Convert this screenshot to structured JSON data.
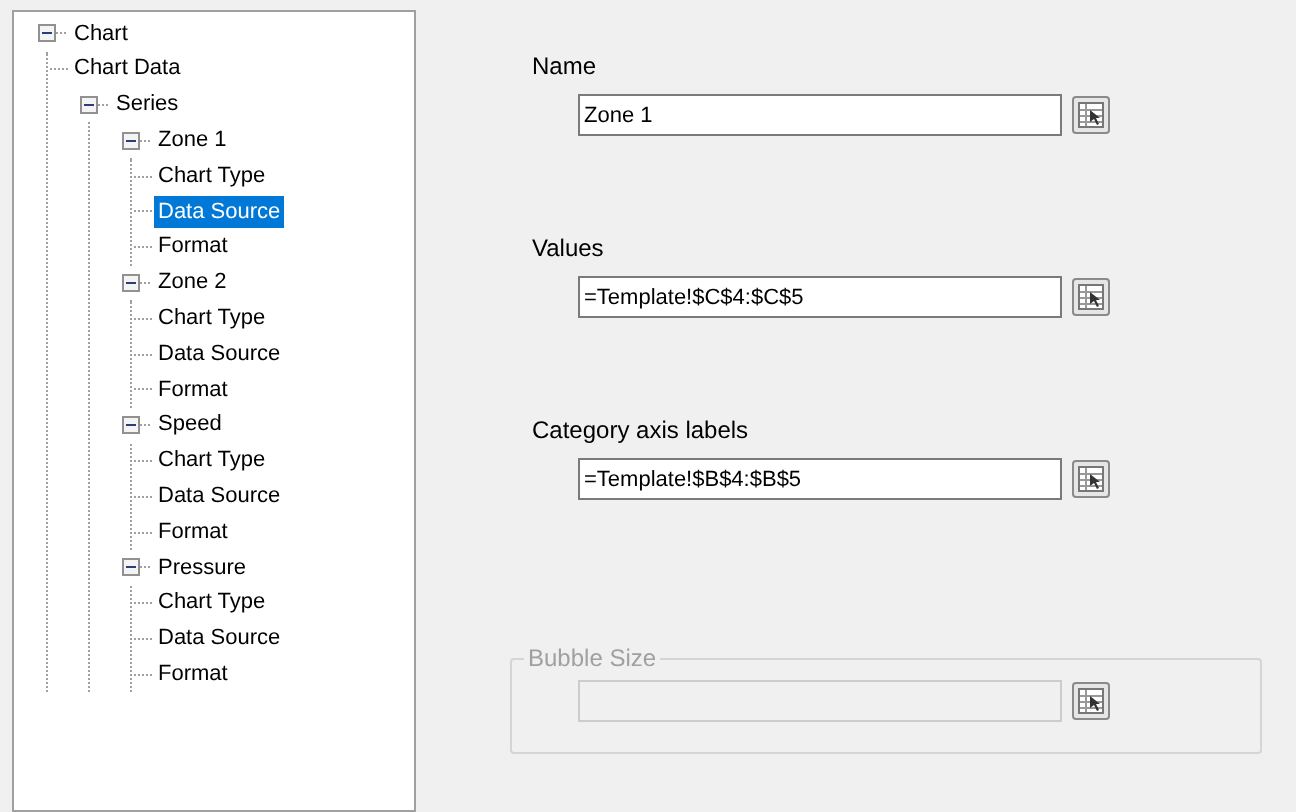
{
  "tree": [
    {
      "label": "Chart",
      "expanded": true,
      "selected": false,
      "children": [
        {
          "label": "Chart Data",
          "selected": false
        },
        {
          "label": "Series",
          "expanded": true,
          "selected": false,
          "children": [
            {
              "label": "Zone 1",
              "expanded": true,
              "selected": false,
              "children": [
                {
                  "label": "Chart Type",
                  "selected": false
                },
                {
                  "label": "Data Source",
                  "selected": true
                },
                {
                  "label": "Format",
                  "selected": false
                }
              ]
            },
            {
              "label": "Zone 2",
              "expanded": true,
              "selected": false,
              "children": [
                {
                  "label": "Chart Type",
                  "selected": false
                },
                {
                  "label": "Data Source",
                  "selected": false
                },
                {
                  "label": "Format",
                  "selected": false
                }
              ]
            },
            {
              "label": "Speed",
              "expanded": true,
              "selected": false,
              "children": [
                {
                  "label": "Chart Type",
                  "selected": false
                },
                {
                  "label": "Data Source",
                  "selected": false
                },
                {
                  "label": "Format",
                  "selected": false
                }
              ]
            },
            {
              "label": "Pressure",
              "expanded": true,
              "selected": false,
              "children": [
                {
                  "label": "Chart Type",
                  "selected": false
                },
                {
                  "label": "Data Source",
                  "selected": false
                },
                {
                  "label": "Format",
                  "selected": false
                }
              ]
            }
          ]
        }
      ]
    }
  ],
  "fields": [
    {
      "label": "Name",
      "value": "Zone 1"
    },
    {
      "label": "Values",
      "value": "=Template!$C$4:$C$5"
    },
    {
      "label": "Category axis labels",
      "value": "=Template!$B$4:$B$5"
    }
  ],
  "bubble_size": {
    "legend": "Bubble Size",
    "disabled": true
  }
}
